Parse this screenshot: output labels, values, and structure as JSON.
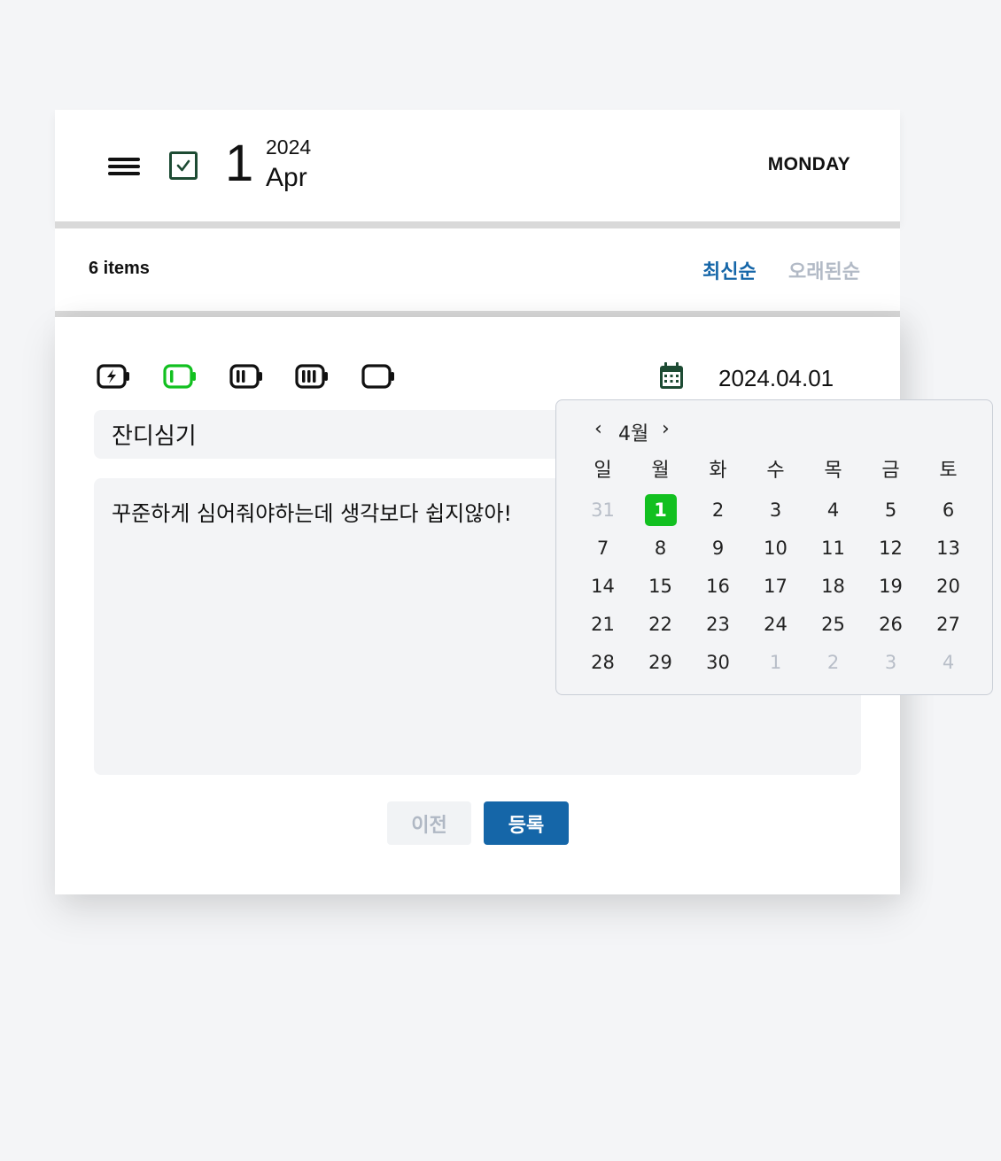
{
  "header": {
    "day": "1",
    "year": "2024",
    "month": "Apr",
    "weekday": "MONDAY"
  },
  "list": {
    "count_label": "6 items",
    "sort_newest": "최신순",
    "sort_oldest": "오래된순"
  },
  "form": {
    "battery_icons": [
      "battery-charging-icon",
      "battery-low-icon",
      "battery-medium-icon",
      "battery-full-icon",
      "battery-empty-icon"
    ],
    "selected_battery": "battery-low-icon",
    "accent_color": "#12c020",
    "date": "2024.04.01",
    "title_value": "잔디심기",
    "body_value": "꾸준하게 심어줘야하는데 생각보다 쉽지않아!",
    "prev_label": "이전",
    "submit_label": "등록"
  },
  "calendar": {
    "month_label": "4월",
    "prev_icon": "‹",
    "next_icon": "›",
    "weekdays": [
      "일",
      "월",
      "화",
      "수",
      "목",
      "금",
      "토"
    ],
    "selected": "1",
    "weeks": [
      [
        {
          "d": "31",
          "m": true
        },
        {
          "d": "1",
          "s": true
        },
        {
          "d": "2"
        },
        {
          "d": "3"
        },
        {
          "d": "4"
        },
        {
          "d": "5"
        },
        {
          "d": "6"
        }
      ],
      [
        {
          "d": "7"
        },
        {
          "d": "8"
        },
        {
          "d": "9"
        },
        {
          "d": "10"
        },
        {
          "d": "11"
        },
        {
          "d": "12"
        },
        {
          "d": "13"
        }
      ],
      [
        {
          "d": "14"
        },
        {
          "d": "15"
        },
        {
          "d": "16"
        },
        {
          "d": "17"
        },
        {
          "d": "18"
        },
        {
          "d": "19"
        },
        {
          "d": "20"
        }
      ],
      [
        {
          "d": "21"
        },
        {
          "d": "22"
        },
        {
          "d": "23"
        },
        {
          "d": "24"
        },
        {
          "d": "25"
        },
        {
          "d": "26"
        },
        {
          "d": "27"
        }
      ],
      [
        {
          "d": "28"
        },
        {
          "d": "29"
        },
        {
          "d": "30"
        },
        {
          "d": "1",
          "m": true
        },
        {
          "d": "2",
          "m": true
        },
        {
          "d": "3",
          "m": true
        },
        {
          "d": "4",
          "m": true
        }
      ]
    ]
  }
}
